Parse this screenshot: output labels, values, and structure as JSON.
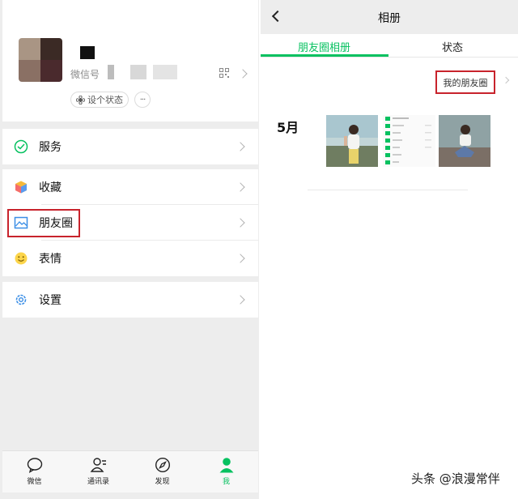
{
  "left": {
    "profile": {
      "wechat_id_label": "微信号",
      "status_button": "设个状态",
      "more": "···"
    },
    "menu": [
      {
        "label": "服务",
        "icon": "service-icon"
      },
      {
        "label": "收藏",
        "icon": "favorites-cube-icon"
      },
      {
        "label": "朋友圈",
        "icon": "moments-image-icon"
      },
      {
        "label": "表情",
        "icon": "sticker-smile-icon"
      },
      {
        "label": "设置",
        "icon": "settings-gear-icon"
      }
    ],
    "tabbar": [
      {
        "label": "微信",
        "icon": "chat-bubble-icon"
      },
      {
        "label": "通讯录",
        "icon": "contacts-icon"
      },
      {
        "label": "发现",
        "icon": "compass-icon"
      },
      {
        "label": "我",
        "icon": "me-person-icon",
        "active": true
      }
    ]
  },
  "right": {
    "title": "相册",
    "tabs": [
      {
        "label": "朋友圈相册",
        "active": true
      },
      {
        "label": "状态",
        "active": false
      }
    ],
    "my_moments": "我的朋友圈",
    "month": "5月"
  },
  "watermark": "头条 @浪漫常伴",
  "colors": {
    "accent": "#07c160",
    "highlight": "#c8232c",
    "background": "#ededed"
  }
}
